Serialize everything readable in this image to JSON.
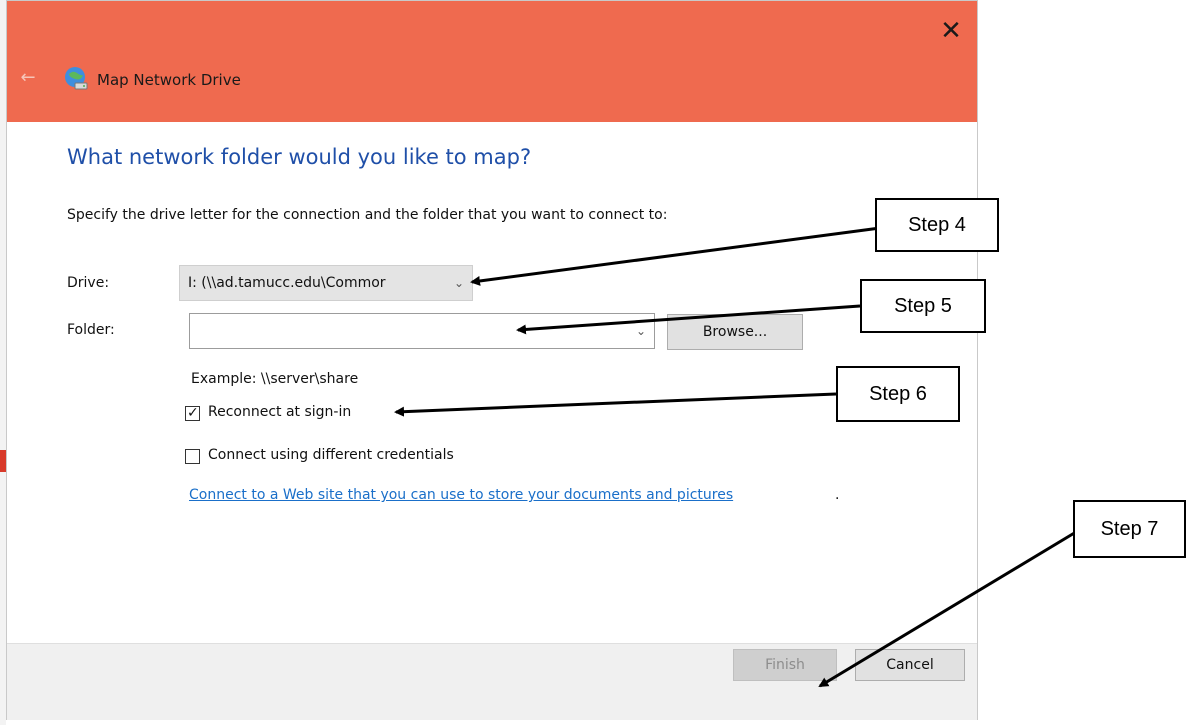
{
  "window": {
    "title": "Map Network Drive",
    "close_glyph": "✕",
    "back_glyph": "←",
    "icon": "network-drive-icon"
  },
  "main": {
    "heading": "What network folder would you like to map?",
    "instruction": "Specify the drive letter for the connection and the folder that you want to connect to:",
    "drive_label": "Drive:",
    "drive_value": "I: (\\\\ad.tamucc.edu\\Commor",
    "folder_label": "Folder:",
    "folder_value": "",
    "browse_label": "Browse...",
    "example": "Example: \\\\server\\share",
    "reconnect_label": "Reconnect at sign-in",
    "reconnect_checked": true,
    "credentials_label": "Connect using different credentials",
    "credentials_checked": false,
    "web_link": "Connect to a Web site that you can use to store your documents and pictures",
    "web_link_suffix": "."
  },
  "footer": {
    "finish_label": "Finish",
    "cancel_label": "Cancel"
  },
  "annotations": {
    "step4": "Step 4",
    "step5": "Step 5",
    "step6": "Step 6",
    "step7": "Step 7"
  },
  "colors": {
    "titlebar": "#ef6a4f",
    "heading": "#1f4fa8",
    "link": "#1a6fc9"
  }
}
